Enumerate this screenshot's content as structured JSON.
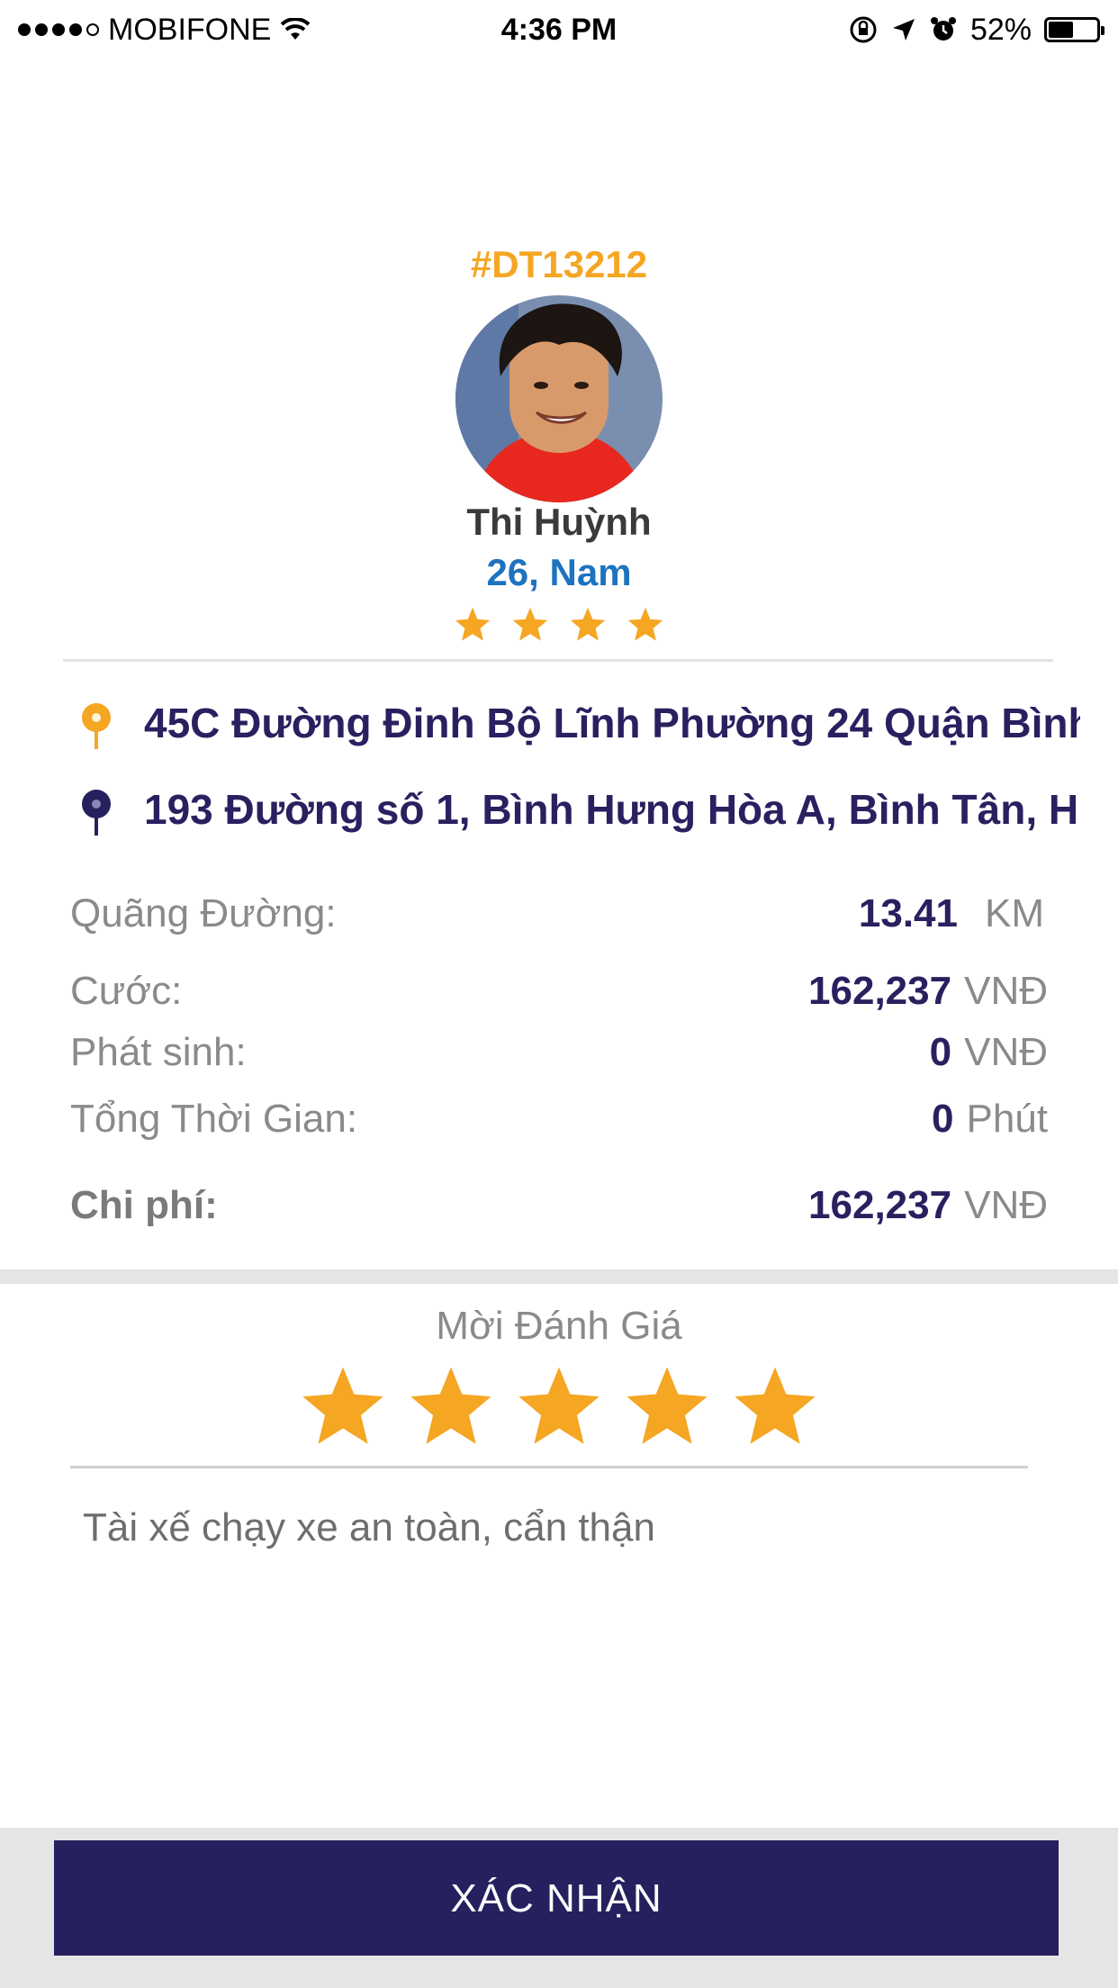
{
  "status_bar": {
    "carrier": "MOBIFONE",
    "time": "4:36 PM",
    "battery": "52%",
    "battery_level": 0.52,
    "signal_dots_filled": 4,
    "signal_dots_total": 5
  },
  "driver": {
    "trip_id": "#DT13212",
    "name": "Thi Huỳnh",
    "age_gender": "26, Nam",
    "rating": 4,
    "rating_max": 4
  },
  "route": {
    "pickup": "45C Đường Đinh Bộ Lĩnh Phường 24 Quận Bình...",
    "dropoff": "193 Đường số 1, Bình Hưng Hòa A, Bình Tân, H..."
  },
  "summary": {
    "distance": {
      "label": "Quãng Đường:",
      "value": "13.41",
      "unit": "KM"
    },
    "fare": {
      "label": "Cước:",
      "value": "162,237",
      "unit": "VNĐ"
    },
    "extra": {
      "label": "Phát sinh:",
      "value": "0",
      "unit": "VNĐ"
    },
    "time": {
      "label": "Tổng Thời Gian:",
      "value": "0",
      "unit": "Phút"
    },
    "total": {
      "label": "Chi phí:",
      "value": "162,237",
      "unit": "VNĐ"
    }
  },
  "rating_form": {
    "title": "Mời Đánh Giá",
    "stars_selected": 5,
    "stars_total": 5,
    "comment": "Tài xế chạy xe an toàn, cẩn thận"
  },
  "confirm_button": {
    "label": "XÁC NHẬN"
  },
  "colors": {
    "accent_orange": "#f5a623",
    "navy": "#26205e",
    "blue": "#1e73be"
  }
}
